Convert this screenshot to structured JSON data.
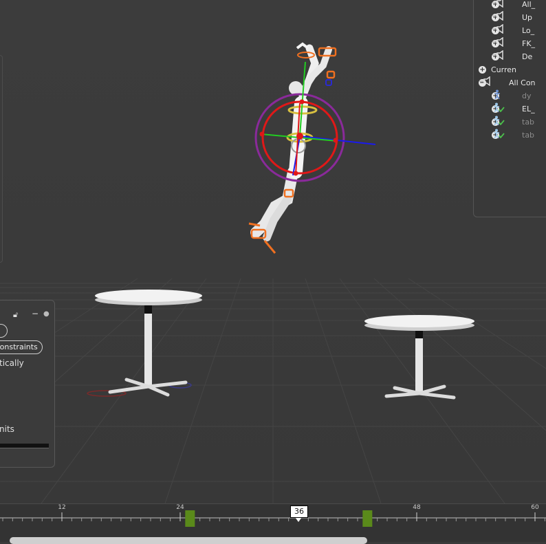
{
  "outliner": {
    "rows": [
      {
        "label": "All_",
        "level": 1,
        "expander": "+",
        "icon": "speaker-icon",
        "dim": false
      },
      {
        "label": "Up",
        "level": 1,
        "expander": "+",
        "icon": "speaker-icon",
        "dim": false
      },
      {
        "label": "Lo_",
        "level": 1,
        "expander": "+",
        "icon": "speaker-icon",
        "dim": false
      },
      {
        "label": "FK_",
        "level": 1,
        "expander": "+",
        "icon": "speaker-icon",
        "dim": false
      },
      {
        "label": "De",
        "level": 1,
        "expander": "+",
        "icon": "speaker-icon",
        "dim": false
      },
      {
        "label": "Curren",
        "level": 0,
        "expander": "+",
        "icon": "",
        "dim": false
      },
      {
        "label": "All Con",
        "level": 0,
        "expander": "−",
        "icon": "speaker-icon",
        "dim": false
      },
      {
        "label": "dy",
        "level": 1,
        "expander": "+",
        "icon": "figure-icon",
        "dim": true
      },
      {
        "label": "EL_",
        "level": 1,
        "expander": "+",
        "icon": "figure-check-icon",
        "dim": false
      },
      {
        "label": "tab",
        "level": 1,
        "expander": "+",
        "icon": "figure-check-icon",
        "dim": true
      },
      {
        "label": "tab",
        "level": 1,
        "expander": "+",
        "icon": "figure-check-icon",
        "dim": true
      }
    ]
  },
  "left_panel": {
    "pill_top_label": "",
    "constraints_label": "Constraints",
    "auto_text": "tically",
    "units_text": "nits",
    "minus_label": "−"
  },
  "timeline": {
    "ticks": [
      {
        "label": "12",
        "frame": 12
      },
      {
        "label": "24",
        "frame": 24
      },
      {
        "label": "48",
        "frame": 48
      },
      {
        "label": "60",
        "frame": 60
      }
    ],
    "current_frame": "36",
    "keyframes": [
      25,
      43
    ]
  },
  "colors": {
    "keyframe": "#5a8a1a",
    "rig_red": "#e01818",
    "rig_purple": "#8a2a9a",
    "axis_green": "#22cc22",
    "axis_blue": "#1a1aee",
    "control_orange": "#f07020"
  }
}
